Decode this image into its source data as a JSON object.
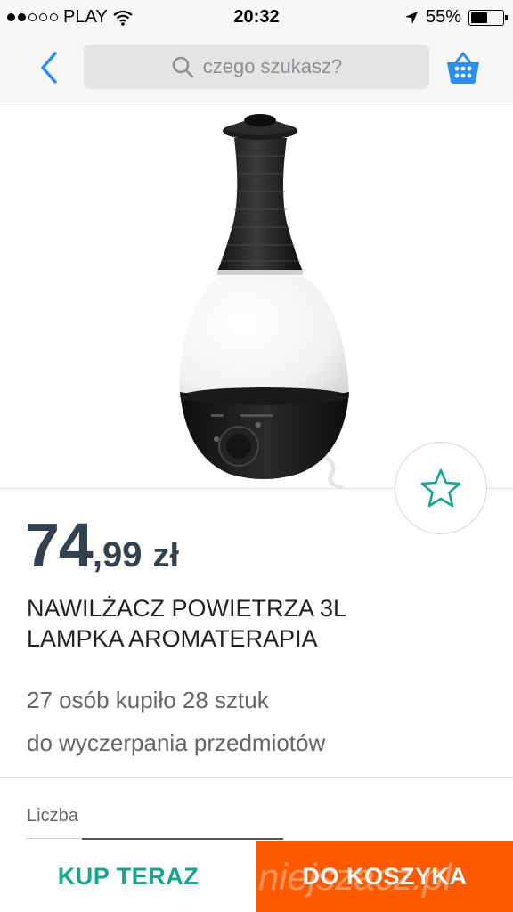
{
  "status_bar": {
    "carrier": "PLAY",
    "time": "20:32",
    "battery": "55%",
    "battery_level": 0.55,
    "signal_bars_filled": 2,
    "signal_bars_total": 5
  },
  "nav": {
    "search_placeholder": "czego szukasz?"
  },
  "product": {
    "price_integer": "74",
    "price_decimal": ",99",
    "price_currency": "zł",
    "title_line1": "NAWILŻACZ POWIETRZA 3L",
    "title_line2": "LAMPKA AROMATERAPIA",
    "sold_info": "27 osób kupiło 28 sztuk",
    "availability": "do wyczerpania przedmiotów",
    "quantity_label": "Liczba"
  },
  "actions": {
    "buy_now": "KUP TERAZ",
    "add_to_cart": "DO KOSZYKA"
  },
  "watermark": "niejszacz.pl",
  "colors": {
    "accent_blue": "#2b8ef0",
    "buy_now_green": "#17a58d",
    "add_to_cart_orange": "#ff5a00",
    "price_dark": "#33414e"
  }
}
